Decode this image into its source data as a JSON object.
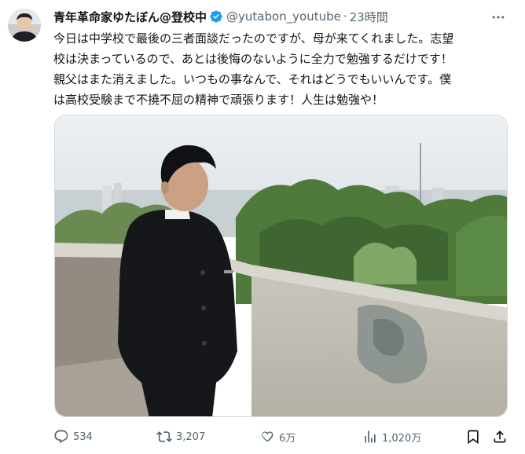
{
  "tweet": {
    "display_name": "青年革命家ゆたぼん@登校中",
    "handle": "@yutabon_youtube",
    "separator": "·",
    "time": "23時間",
    "text_lines": [
      "今日は中学校で最後の三者面談だったのですが、母が来てくれました。志望",
      "校は決まっているので、あとは後悔のないように全力で勉強するだけです！",
      "親父はまた消えました。いつもの事なんで、それはどうでもいいんです。僕",
      "は高校受験まで不撓不屈の精神で頑張ります！人生は勉強や！"
    ]
  },
  "actions": {
    "reply_count": "534",
    "retweet_count": "3,207",
    "like_count": "6万",
    "view_count": "1,020万"
  },
  "icons": {
    "verified": "verified-badge-icon",
    "more": "more-options-icon",
    "reply": "reply-icon",
    "retweet": "retweet-icon",
    "like": "heart-icon",
    "views": "bar-chart-icon",
    "bookmark": "bookmark-icon",
    "share": "share-icon"
  },
  "colors": {
    "text": "#0f1419",
    "secondary": "#536471",
    "verified": "#1d9bf0",
    "border": "#cfd9de"
  }
}
